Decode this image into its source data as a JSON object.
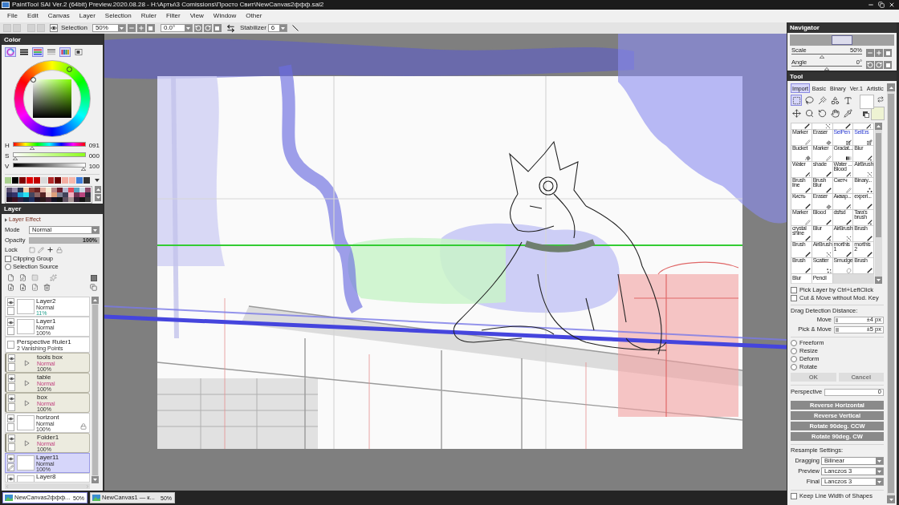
{
  "window": {
    "title": "PaintTool SAI Ver.2 (64bit) Preview.2020.08.28 - H:\\Арты\\3 Comissions\\Просто Свит\\NewCanvas2ффф.sai2"
  },
  "menu": [
    "File",
    "Edit",
    "Canvas",
    "Layer",
    "Selection",
    "Ruler",
    "Filter",
    "View",
    "Window",
    "Other"
  ],
  "toolbar": {
    "selection_label": "Selection",
    "zoom": "50%",
    "angle": "0.0°",
    "stabilizer_label": "Stabilizer",
    "stabilizer": "6"
  },
  "color_panel": {
    "title": "Color",
    "modes": [
      {
        "kind": "wheel",
        "selected": true
      },
      {
        "kind": "bars",
        "selected": false
      },
      {
        "kind": "rgb",
        "selected": true
      },
      {
        "kind": "hsv",
        "selected": false
      },
      {
        "kind": "palette",
        "selected": true
      },
      {
        "kind": "scratch",
        "selected": false
      }
    ],
    "sliders": [
      {
        "kind": "hue",
        "label": "H",
        "value": "091",
        "level": 0.25
      },
      {
        "kind": "saturation",
        "label": "S",
        "value": "000",
        "level": 0
      },
      {
        "kind": "value",
        "label": "V",
        "value": "100",
        "level": 1
      }
    ],
    "swatches": [
      {
        "color": "#a9d18e"
      },
      {
        "color": "#000000"
      },
      {
        "color": "#7f0000"
      },
      {
        "color": "#e00000"
      },
      {
        "color": "#c00000"
      },
      {
        "color": "#d9d9d9"
      },
      {
        "color": "#b22828"
      },
      {
        "color": "#6a0000"
      },
      {
        "color": "#f4ada2"
      },
      {
        "color": "#f6b8ac"
      },
      {
        "color": "#3c7dd9"
      },
      {
        "color": "#323232"
      }
    ],
    "palette": [
      {
        "color": "#5b5070"
      },
      {
        "color": "#9a8fb0"
      },
      {
        "color": "#2c3550"
      },
      {
        "color": "#f2cfa8"
      },
      {
        "color": "#8a3b33"
      },
      {
        "color": "#6b2222"
      },
      {
        "color": "#e3b0a2"
      },
      {
        "color": "#f4ead2"
      },
      {
        "color": "#b98585"
      },
      {
        "color": "#6b1c2c"
      },
      {
        "color": "#b8b8d0"
      },
      {
        "color": "#e5485a"
      },
      {
        "color": "#5aa3c2"
      },
      {
        "color": "#cfdde8"
      },
      {
        "color": "#8a4a6a"
      },
      {
        "color": "#2b2b55"
      },
      {
        "color": "#34346b"
      },
      {
        "color": "#19a6d6"
      },
      {
        "color": "#27e2f2"
      },
      {
        "color": "#45465f"
      },
      {
        "color": "#8a6464"
      },
      {
        "color": "#552424"
      },
      {
        "color": "#f1d6c6"
      },
      {
        "color": "#dca07c"
      },
      {
        "color": "#7d7f93"
      },
      {
        "color": "#404258"
      },
      {
        "color": "#f0b2c2"
      },
      {
        "color": "#6e3252"
      },
      {
        "color": "#b8467e"
      },
      {
        "color": "#2a2a3a"
      },
      {
        "color": "#1e101e"
      },
      {
        "color": "#3d1020"
      },
      {
        "color": "#2e2244"
      },
      {
        "color": "#10223e"
      },
      {
        "color": "#1f3160"
      },
      {
        "color": "#211221"
      },
      {
        "color": "#2b1a1b"
      },
      {
        "color": "#432233"
      },
      {
        "color": "#121224"
      },
      {
        "color": "#101010"
      },
      {
        "color": "#5f5262"
      },
      {
        "color": "#a69494"
      },
      {
        "color": "#2f1f31"
      },
      {
        "color": "#141414"
      },
      {
        "color": "#3a3a3a"
      }
    ]
  },
  "layer_panel": {
    "title": "Layer",
    "effect": "Layer Effect",
    "mode": {
      "label": "Mode",
      "value": "Normal"
    },
    "opacity": {
      "label": "Opacity",
      "value": "100%",
      "level": 1
    },
    "lock_label": "Lock",
    "clipping": {
      "label": "Clipping Group",
      "checked": false
    },
    "selection_source": {
      "label": "Selection Source",
      "checked": false
    },
    "layers": [
      {
        "kind": "layer",
        "name": "Layer2",
        "mode": "Normal",
        "opacity": "11%",
        "opacity_tinted": true,
        "visible": true,
        "locked": false,
        "selected": false
      },
      {
        "kind": "layer",
        "name": "Layer1",
        "mode": "Normal",
        "opacity": "100%",
        "opacity_tinted": false,
        "visible": true,
        "locked": false,
        "selected": false
      },
      {
        "kind": "ruler",
        "name": "Perspective Ruler1",
        "detail": "2 Vanishing Points",
        "visible": false,
        "selected": false
      },
      {
        "kind": "folder",
        "name": "tools box",
        "mode": "Normal",
        "opacity": "100%",
        "opacity_tinted": false,
        "visible": true,
        "locked": false,
        "expanded": false,
        "selected": false
      },
      {
        "kind": "folder",
        "name": "table",
        "mode": "Normal",
        "opacity": "100%",
        "opacity_tinted": false,
        "visible": true,
        "locked": false,
        "expanded": false,
        "selected": false
      },
      {
        "kind": "folder",
        "name": "box",
        "mode": "Normal",
        "opacity": "100%",
        "opacity_tinted": false,
        "visible": true,
        "locked": false,
        "expanded": false,
        "selected": false
      },
      {
        "kind": "layer",
        "name": "horizont",
        "mode": "Normal",
        "opacity": "100%",
        "opacity_tinted": false,
        "visible": true,
        "locked": true,
        "selected": false
      },
      {
        "kind": "folder",
        "name": "Folder1",
        "mode": "Normal",
        "opacity": "100%",
        "opacity_tinted": false,
        "visible": true,
        "locked": false,
        "expanded": false,
        "selected": false
      },
      {
        "kind": "layer",
        "name": "Layer11",
        "mode": "Normal",
        "opacity": "100%",
        "opacity_tinted": false,
        "visible": true,
        "locked": false,
        "selected": true
      },
      {
        "kind": "layer",
        "name": "Layer8",
        "visible": true,
        "selected": false
      }
    ]
  },
  "navigator": {
    "title": "Navigator",
    "scale": {
      "label": "Scale",
      "value": "50%",
      "level": 0.43
    },
    "angle": {
      "label": "Angle",
      "value": "0°",
      "level": 0.5
    }
  },
  "tool_panel": {
    "title": "Tool",
    "tabs": [
      {
        "label": "Import",
        "selected": true
      },
      {
        "label": "Basic",
        "selected": false
      },
      {
        "label": "Binary",
        "selected": false
      },
      {
        "label": "Ver.1",
        "selected": false
      },
      {
        "label": "Artistic",
        "selected": false
      }
    ],
    "tools": [
      {
        "kind": "rect-select",
        "selected": true
      },
      {
        "kind": "lasso",
        "selected": false
      },
      {
        "kind": "magic-wand",
        "selected": false
      },
      {
        "kind": "shapes",
        "selected": false
      },
      {
        "kind": "text",
        "selected": false
      },
      {
        "kind": "move",
        "selected": false
      },
      {
        "kind": "zoom",
        "selected": false
      },
      {
        "kind": "rotate",
        "selected": false
      },
      {
        "kind": "hand",
        "selected": false
      },
      {
        "kind": "eyedropper",
        "selected": false
      }
    ],
    "current_colors": [
      {
        "color": "#ffffff"
      },
      {
        "color": "#eef3d3"
      }
    ],
    "brushes": [
      {
        "kind": "pen"
      },
      {
        "kind": "airbrush"
      },
      {
        "kind": "pen"
      },
      {
        "kind": "water"
      },
      {
        "name": "Marker",
        "kind": "marker"
      },
      {
        "name": "Eraser",
        "kind": "eraser"
      },
      {
        "name": "SelPen",
        "kind": "selpen"
      },
      {
        "name": "SelErs",
        "kind": "selers"
      },
      {
        "name": "Bucket",
        "kind": "bucket"
      },
      {
        "name": "Marker",
        "kind": "marker"
      },
      {
        "name": "Gradat...",
        "kind": "gradient"
      },
      {
        "name": "Blur",
        "kind": "blur"
      },
      {
        "name": "Water",
        "kind": "water"
      },
      {
        "name": "shade",
        "kind": "pen"
      },
      {
        "name": "Water ... Blood",
        "kind": "water"
      },
      {
        "name": "AirBrush",
        "kind": "airbrush"
      },
      {
        "name": "Brush line",
        "kind": "pen"
      },
      {
        "name": "Brush Blur",
        "kind": "pen"
      },
      {
        "name": "Скетч",
        "kind": "marker"
      },
      {
        "name": "Binary...",
        "kind": "binary"
      },
      {
        "name": "Кисть",
        "kind": "pen"
      },
      {
        "name": "Eraser",
        "kind": "eraser"
      },
      {
        "name": "Аквар...",
        "kind": "water"
      },
      {
        "name": "experi...",
        "kind": "pen"
      },
      {
        "name": "Marker",
        "kind": "marker"
      },
      {
        "name": "Blood",
        "kind": "pen"
      },
      {
        "name": "dsfsd",
        "kind": "pen"
      },
      {
        "name": "Tara's brush",
        "kind": "blur"
      },
      {
        "name": "crystal shine",
        "kind": "pen"
      },
      {
        "name": "Blur",
        "kind": "blur"
      },
      {
        "name": "AirBrush",
        "kind": "airbrush"
      },
      {
        "name": "Brush",
        "kind": "pen"
      },
      {
        "name": "Brush",
        "kind": "pen"
      },
      {
        "name": "AirBrush",
        "kind": "airbrush"
      },
      {
        "name": "morthis 1",
        "kind": "pen"
      },
      {
        "name": "morthis 2",
        "kind": "pen"
      },
      {
        "name": "Brush",
        "kind": "pen"
      },
      {
        "name": "Scatter",
        "kind": "scatter"
      },
      {
        "name": "Smudge",
        "kind": "smudge"
      },
      {
        "name": "Brush",
        "kind": "pen"
      },
      {
        "name": "Blur"
      },
      {
        "name": "Pencil"
      }
    ],
    "pick_layer": {
      "label": "Pick Layer by Ctrl+LeftClick",
      "checked": false
    },
    "cut_move": {
      "label": "Cut & Move without Mod. Key",
      "checked": false
    },
    "drag_title": "Drag Detection Distance:",
    "distances": [
      {
        "label": "Move",
        "value": "±4 px",
        "level": 0.05
      },
      {
        "label": "Pick & Move",
        "value": "±5 px",
        "level": 0.06
      }
    ],
    "transforms": [
      {
        "label": "Freeform",
        "selected": false
      },
      {
        "label": "Resize",
        "selected": false
      },
      {
        "label": "Deform",
        "selected": false
      },
      {
        "label": "Rotate",
        "selected": false
      }
    ],
    "confirm": [
      {
        "label": "OK",
        "disabled": true
      },
      {
        "label": "Cancel",
        "disabled": true
      }
    ],
    "perspective": {
      "label": "Perspective",
      "value": "0"
    },
    "actions": [
      "Reverse Horizontal",
      "Reverse Vertical",
      "Rotate 90deg. CCW",
      "Rotate 90deg. CW"
    ],
    "resample_title": "Resample Settings:",
    "resample": [
      {
        "label": "Dragging",
        "value": "Bilinear"
      },
      {
        "label": "Preview",
        "value": "Lanczos 3"
      },
      {
        "label": "Final",
        "value": "Lanczos 3"
      }
    ],
    "keep_line_width": {
      "label": "Keep Line Width of Shapes",
      "checked": false
    }
  },
  "documents": [
    {
      "name": "NewCanvas2ффф...",
      "zoom": "50%",
      "selected": true
    },
    {
      "name": "NewCanvas1 — к...",
      "zoom": "50%",
      "selected": false
    }
  ]
}
